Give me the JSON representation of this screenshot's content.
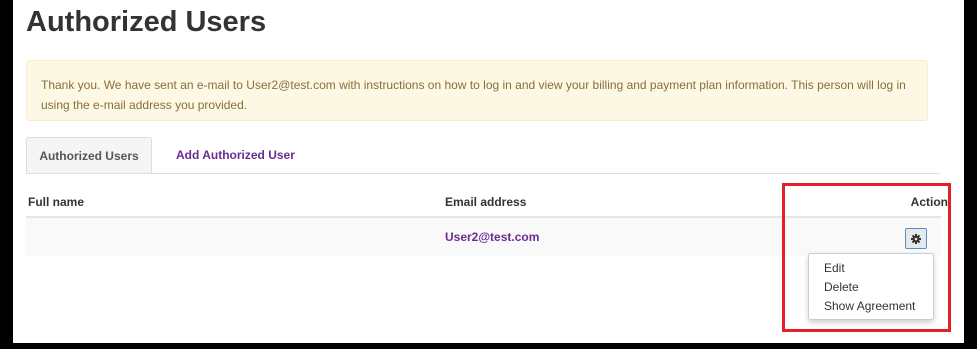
{
  "page": {
    "title": "Authorized Users"
  },
  "alert": {
    "message": "Thank you. We have sent an e-mail to User2@test.com with instructions on how to log in and view your billing and payment plan information. This person will log in using the e-mail address you provided."
  },
  "tabs": [
    {
      "label": "Authorized Users",
      "active": true
    },
    {
      "label": "Add Authorized User",
      "active": false
    }
  ],
  "table": {
    "headers": {
      "full_name": "Full name",
      "email": "Email address",
      "action": "Action"
    },
    "rows": [
      {
        "full_name": "",
        "email": "User2@test.com",
        "action_icon": "gear-icon"
      }
    ]
  },
  "action_menu": {
    "items": [
      {
        "label": "Edit"
      },
      {
        "label": "Delete"
      },
      {
        "label": "Show Agreement"
      }
    ]
  },
  "colors": {
    "link": "#6b2c91",
    "alert_bg": "#fcf8e3",
    "alert_text": "#8a6d3b",
    "annotation": "#e3202a"
  }
}
